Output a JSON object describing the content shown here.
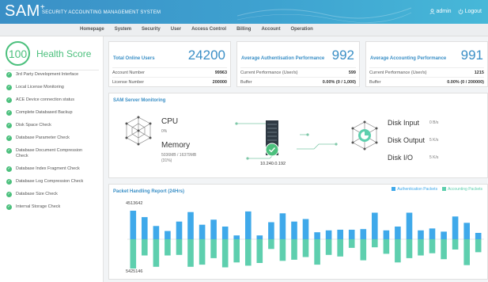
{
  "header": {
    "logo": "SAM",
    "logo_sup": "+",
    "app_title": "SECURITY ACCOUNTING MANAGEMENT SYSTEM",
    "user": "admin",
    "logout": "Logout"
  },
  "nav": [
    "Homepage",
    "System",
    "Security",
    "User",
    "Access Control",
    "Billing",
    "Account",
    "Operation"
  ],
  "sidebar": {
    "score": "100",
    "score_label": "Health Score",
    "checks": [
      "3rd Party Development Interface",
      "Local License Monitoring",
      "ACE Device connection status",
      "Complete Databased Backup",
      "Disk Space Check",
      "Database Parameter Check",
      "Database Document Compression Check",
      "Database Index Fragment Check",
      "Database Log Compression Check",
      "Database Size Check",
      "Internal Storage Check"
    ]
  },
  "cards": {
    "online": {
      "title": "Total Online Users",
      "value": "24200",
      "rows": [
        {
          "label": "Account Number",
          "value": "99963"
        },
        {
          "label": "License Number",
          "value": "200000"
        }
      ]
    },
    "auth": {
      "title": "Average Authentisation Performance",
      "value": "992",
      "rows": [
        {
          "label": "Current Performance (User/s)",
          "value": "599"
        },
        {
          "label": "Buffer",
          "value": "0.00% (0 / 1,000)"
        }
      ]
    },
    "acct": {
      "title": "Average Accounting Performance",
      "value": "991",
      "rows": [
        {
          "label": "Current Performance (User/s)",
          "value": "1215"
        },
        {
          "label": "Buffer",
          "value": "0.00% (0 / 200000)"
        }
      ]
    }
  },
  "monitor": {
    "title": "SAM Server Monitoring",
    "cpu_label": "CPU",
    "cpu_value": "0%",
    "memory_label": "Memory",
    "memory_value": "5036MB / 16379MB",
    "memory_pct": "(31%)",
    "ip": "10.240.0.192",
    "disk_input_label": "Disk Input",
    "disk_input_value": "0 B/s",
    "disk_output_label": "Disk Output",
    "disk_output_value": "5 K/s",
    "disk_io_label": "Disk I/O",
    "disk_io_value": "5 K/s"
  },
  "packet": {
    "title": "Packet Handling Report (24Hrs)",
    "legend_auth": "Authentication Packets",
    "legend_acct": "Accounting Packets",
    "color_auth": "#3fa9ea",
    "color_acct": "#5ecfae",
    "max_label": "4513642",
    "min_label": "5425146"
  },
  "chart_data": {
    "type": "bar",
    "series": [
      {
        "name": "Authentication Packets",
        "values": [
          4513642,
          3500000,
          2100000,
          1300000,
          2800000,
          4300000,
          2300000,
          3100000,
          2000000,
          600000,
          4400000,
          600000,
          2700000,
          4100000,
          2800000,
          3200000,
          1100000,
          1400000,
          1500000,
          1500000,
          1600000,
          4200000,
          1400000,
          2000000,
          4200000,
          1400000,
          1700000,
          1200000,
          3600000,
          2600000,
          1000000
        ]
      },
      {
        "name": "Accounting Packets",
        "values": [
          5425146,
          3000000,
          5100000,
          3000000,
          2900000,
          5100000,
          4700000,
          3500000,
          5200000,
          4300000,
          4900000,
          4400000,
          1800000,
          4000000,
          3800000,
          3300000,
          4700000,
          2900000,
          3200000,
          1600000,
          3900000,
          1500000,
          2700000,
          4300000,
          3500000,
          3000000,
          2600000,
          3700000,
          1900000,
          4800000,
          2400000
        ]
      }
    ]
  },
  "icons": {
    "user": "user-icon",
    "power": "power-icon",
    "check": "check-circle-icon",
    "server": "server-icon"
  }
}
